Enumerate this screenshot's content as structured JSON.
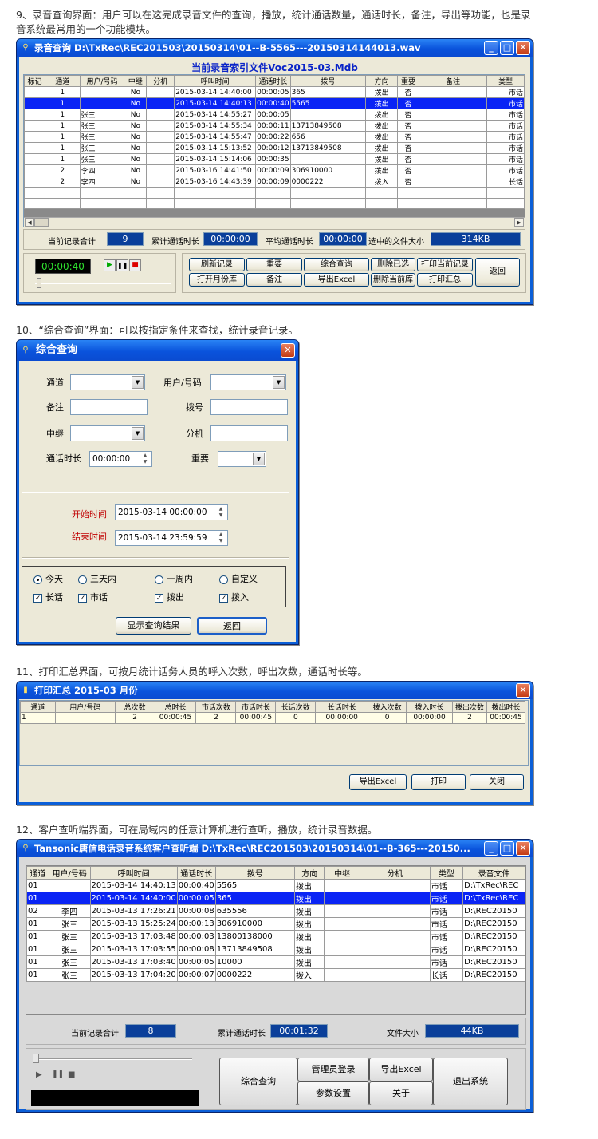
{
  "captions": {
    "c9_line1": "9、录音查询界面：用户可以在这完成录音文件的查询，播放，统计通话数量，通话时长，备注，导出等功能，也是录",
    "c9_line2": "音系统最常用的一个功能模块。",
    "c10": "10、“综合查询”界面：可以按指定条件来查找，统计录音记录。",
    "c11": "11、打印汇总界面，可按月统计话务人员的呼入次数，呼出次数，通话时长等。",
    "c12": "12、客户查听端界面，可在局域内的任意计算机进行查听，播放，统计录音数据。"
  },
  "win1": {
    "title": "录音查询  D:\\TxRec\\REC201503\\20150314\\01--B-5565---20150314144013.wav",
    "index_title": "当前录音索引文件Voc2015-03.Mdb",
    "columns": [
      "标记",
      "通道",
      "用户/号码",
      "中继",
      "分机",
      "呼叫时间",
      "通话时长",
      "拨号",
      "方向",
      "重要",
      "备注",
      "类型"
    ],
    "rows": [
      [
        "",
        "1",
        "",
        "No",
        "",
        "2015-03-14 14:40:00",
        "00:00:05",
        "365",
        "拨出",
        "否",
        "",
        "市话"
      ],
      [
        "",
        "1",
        "",
        "No",
        "",
        "2015-03-14 14:40:13",
        "00:00:40",
        "5565",
        "拨出",
        "否",
        "",
        "市话"
      ],
      [
        "",
        "1",
        "张三",
        "No",
        "",
        "2015-03-14 14:55:27",
        "00:00:05",
        "",
        "拨出",
        "否",
        "",
        "市话"
      ],
      [
        "",
        "1",
        "张三",
        "No",
        "",
        "2015-03-14 14:55:34",
        "00:00:11",
        "13713849508",
        "拨出",
        "否",
        "",
        "市话"
      ],
      [
        "",
        "1",
        "张三",
        "No",
        "",
        "2015-03-14 14:55:47",
        "00:00:22",
        "656",
        "拨出",
        "否",
        "",
        "市话"
      ],
      [
        "",
        "1",
        "张三",
        "No",
        "",
        "2015-03-14 15:13:52",
        "00:00:12",
        "13713849508",
        "拨出",
        "否",
        "",
        "市话"
      ],
      [
        "",
        "1",
        "张三",
        "No",
        "",
        "2015-03-14 15:14:06",
        "00:00:35",
        "",
        "拨出",
        "否",
        "",
        "市话"
      ],
      [
        "",
        "2",
        "李四",
        "No",
        "",
        "2015-03-16 14:41:50",
        "00:00:09",
        "306910000",
        "拨出",
        "否",
        "",
        "市话"
      ],
      [
        "",
        "2",
        "李四",
        "No",
        "",
        "2015-03-16 14:43:39",
        "00:00:09",
        "0000222",
        "拨入",
        "否",
        "",
        "长话"
      ]
    ],
    "selected_row": 1,
    "total_label": "当前记录合计",
    "total_value": "9",
    "dur_label": "累计通话时长",
    "dur_value": "00:00:00",
    "avg_label": "平均通话时长",
    "avg_value": "00:00:00",
    "size_label": "选中的文件大小",
    "size_value": "314KB",
    "player_time": "00:00:40",
    "buttons": {
      "refresh": "刷新记录",
      "important": "重要",
      "search": "综合查询",
      "del_sel": "删除已选",
      "print_cur": "打印当前记录",
      "open_month": "打开月份库",
      "note": "备注",
      "export": "导出Excel",
      "del_lib": "删除当前库",
      "print_sum": "打印汇总",
      "back": "返回"
    }
  },
  "win2": {
    "title": "综合查询",
    "labels": {
      "channel": "通道",
      "user": "用户/号码",
      "note": "备注",
      "dial": "拨号",
      "trunk": "中继",
      "ext": "分机",
      "duration": "通话时长",
      "important": "重要",
      "start": "开始时间",
      "end": "结束时间"
    },
    "duration_value": "00:00:00",
    "start_value": "2015-03-14 00:00:00",
    "end_value": "2015-03-14 23:59:59",
    "radios": [
      "今天",
      "三天内",
      "一周内",
      "自定义"
    ],
    "checks": [
      "长话",
      "市话",
      "拨出",
      "拨入"
    ],
    "btn_show": "显示查询结果",
    "btn_back": "返回"
  },
  "win3": {
    "title": "打印汇总   2015-03 月份",
    "columns": [
      "通道",
      "用户/号码",
      "总次数",
      "总时长",
      "市话次数",
      "市话时长",
      "长话次数",
      "长话时长",
      "拨入次数",
      "拨入时长",
      "拨出次数",
      "拨出时长"
    ],
    "row": [
      "1",
      "",
      "2",
      "00:00:45",
      "2",
      "00:00:45",
      "0",
      "00:00:00",
      "0",
      "00:00:00",
      "2",
      "00:00:45"
    ],
    "btn_export": "导出Excel",
    "btn_print": "打印",
    "btn_close": "关闭"
  },
  "win4": {
    "title": "Tansonic唐信电话录音系统客户查听端  D:\\TxRec\\REC201503\\20150314\\01--B-365---20150...",
    "columns": [
      "通道",
      "用户/号码",
      "呼叫时间",
      "通话时长",
      "拨号",
      "方向",
      "中继",
      "分机",
      "类型",
      "录音文件"
    ],
    "rows": [
      [
        "01",
        "",
        "2015-03-14 14:40:13",
        "00:00:40",
        "5565",
        "拨出",
        "",
        "",
        "市话",
        "D:\\TxRec\\REC"
      ],
      [
        "01",
        "",
        "2015-03-14 14:40:00",
        "00:00:05",
        "365",
        "拨出",
        "",
        "",
        "市话",
        "D:\\TxRec\\REC"
      ],
      [
        "02",
        "李四",
        "2015-03-13 17:26:21",
        "00:00:08",
        "635556",
        "拨出",
        "",
        "",
        "市话",
        "D:\\REC20150"
      ],
      [
        "01",
        "张三",
        "2015-03-13 15:25:24",
        "00:00:13",
        "306910000",
        "拨出",
        "",
        "",
        "市话",
        "D:\\REC20150"
      ],
      [
        "01",
        "张三",
        "2015-03-13 17:03:48",
        "00:00:03",
        "13800138000",
        "拨出",
        "",
        "",
        "市话",
        "D:\\REC20150"
      ],
      [
        "01",
        "张三",
        "2015-03-13 17:03:55",
        "00:00:08",
        "13713849508",
        "拨出",
        "",
        "",
        "市话",
        "D:\\REC20150"
      ],
      [
        "01",
        "张三",
        "2015-03-13 17:03:40",
        "00:00:05",
        "10000",
        "拨出",
        "",
        "",
        "市话",
        "D:\\REC20150"
      ],
      [
        "01",
        "张三",
        "2015-03-13 17:04:20",
        "00:00:07",
        "0000222",
        "拨入",
        "",
        "",
        "长话",
        "D:\\REC20150"
      ]
    ],
    "selected_row": 1,
    "total_label": "当前记录合计",
    "total_value": "8",
    "dur_label": "累计通话时长",
    "dur_value": "00:01:32",
    "size_label": "文件大小",
    "size_value": "44KB",
    "buttons": {
      "search": "综合查询",
      "admin": "管理员登录",
      "export": "导出Excel",
      "exit": "退出系统",
      "params": "参数设置",
      "about": "关于"
    }
  }
}
